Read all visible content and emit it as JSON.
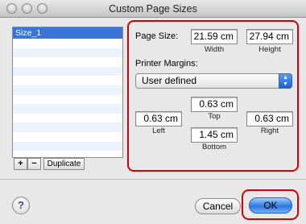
{
  "window": {
    "title": "Custom Page Sizes"
  },
  "list": {
    "items": [
      "Size_1"
    ]
  },
  "list_buttons": {
    "add": "+",
    "remove": "−",
    "duplicate": "Duplicate"
  },
  "page_size": {
    "label": "Page Size:",
    "width_value": "21.59 cm",
    "height_value": "27.94 cm",
    "width_label": "Width",
    "height_label": "Height"
  },
  "margins": {
    "label": "Printer Margins:",
    "popup_value": "User defined",
    "top_value": "0.63 cm",
    "left_value": "0.63 cm",
    "right_value": "0.63 cm",
    "bottom_value": "1.45 cm",
    "top_label": "Top",
    "left_label": "Left",
    "right_label": "Right",
    "bottom_label": "Bottom"
  },
  "footer": {
    "help": "?",
    "cancel": "Cancel",
    "ok": "OK"
  }
}
